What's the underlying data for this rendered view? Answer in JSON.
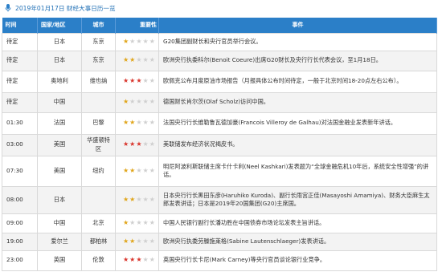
{
  "page": {
    "title": "2019年01月17日 财经大事日历一览"
  },
  "colors": {
    "header_bg": "#2b7fc8",
    "star_low": "#e0a51a",
    "star_high": "#d9342b",
    "star_off": "#cfcfcf"
  },
  "icons": {
    "title_icon": "microphone-icon",
    "rating": "star-icon"
  },
  "table": {
    "headers": [
      "时间",
      "国家/地区",
      "城市",
      "重要性",
      "事件"
    ],
    "rows": [
      {
        "time": "待定",
        "region": "日本",
        "city": "东京",
        "importance": 1,
        "event": "G20集团副财长和央行官员举行会议。"
      },
      {
        "time": "待定",
        "region": "日本",
        "city": "东京",
        "importance": 2,
        "event": "欧洲央行执委科尔(Benoit Coeure)出席G20财长及央行行长代表会议，至1月18日。"
      },
      {
        "time": "待定",
        "region": "奥地利",
        "city": "维也纳",
        "importance": 3,
        "event": "欧佩克公布月度原油市场报告（月报具体公布时间待定，一般于北京时间18-20点左右公布）。"
      },
      {
        "time": "待定",
        "region": "中国",
        "city": "",
        "importance": 1,
        "event": "德国财长肖尔茨(Olaf Scholz)访问中国。"
      },
      {
        "time": "01:30",
        "region": "法国",
        "city": "巴黎",
        "importance": 2,
        "event": "法国央行行长维勒鲁瓦德加豪(Francois Villeroy de Galhau)对法国金融业发表新年讲话。"
      },
      {
        "time": "03:00",
        "region": "美国",
        "city": "华盛顿特区",
        "importance": 3,
        "event": "美联储发布经济状况褐皮书。"
      },
      {
        "time": "07:30",
        "region": "美国",
        "city": "纽约",
        "importance": 2,
        "event": "明尼阿波利斯联储主席卡什卡利(Neel Kashkari)发表题为“全球金融危机10年后，系统安全性增强”的讲话。"
      },
      {
        "time": "08:00",
        "region": "日本",
        "city": "",
        "importance": 2,
        "event": "日本央行行长黑田东彦(Haruhiko Kuroda)、副行长雨宫正佳(Masayoshi Amamiya)、财务大臣麻生太郎发表讲话；日本是2019年20国集团(G20)主席国。"
      },
      {
        "time": "09:00",
        "region": "中国",
        "city": "北京",
        "importance": 1,
        "event": "中国人民银行副行长潘功胜在中国债券市场论坛发表主旨讲话。"
      },
      {
        "time": "19:00",
        "region": "爱尔兰",
        "city": "都柏林",
        "importance": 2,
        "event": "欧洲央行执委劳滕施莱格(Sabine Lautenschlaeger)发表讲话。"
      },
      {
        "time": "23:00",
        "region": "英国",
        "city": "伦敦",
        "importance": 3,
        "event": "英国央行行长卡尼(Mark Carney)等央行官员谈论银行业竞争。"
      }
    ]
  }
}
